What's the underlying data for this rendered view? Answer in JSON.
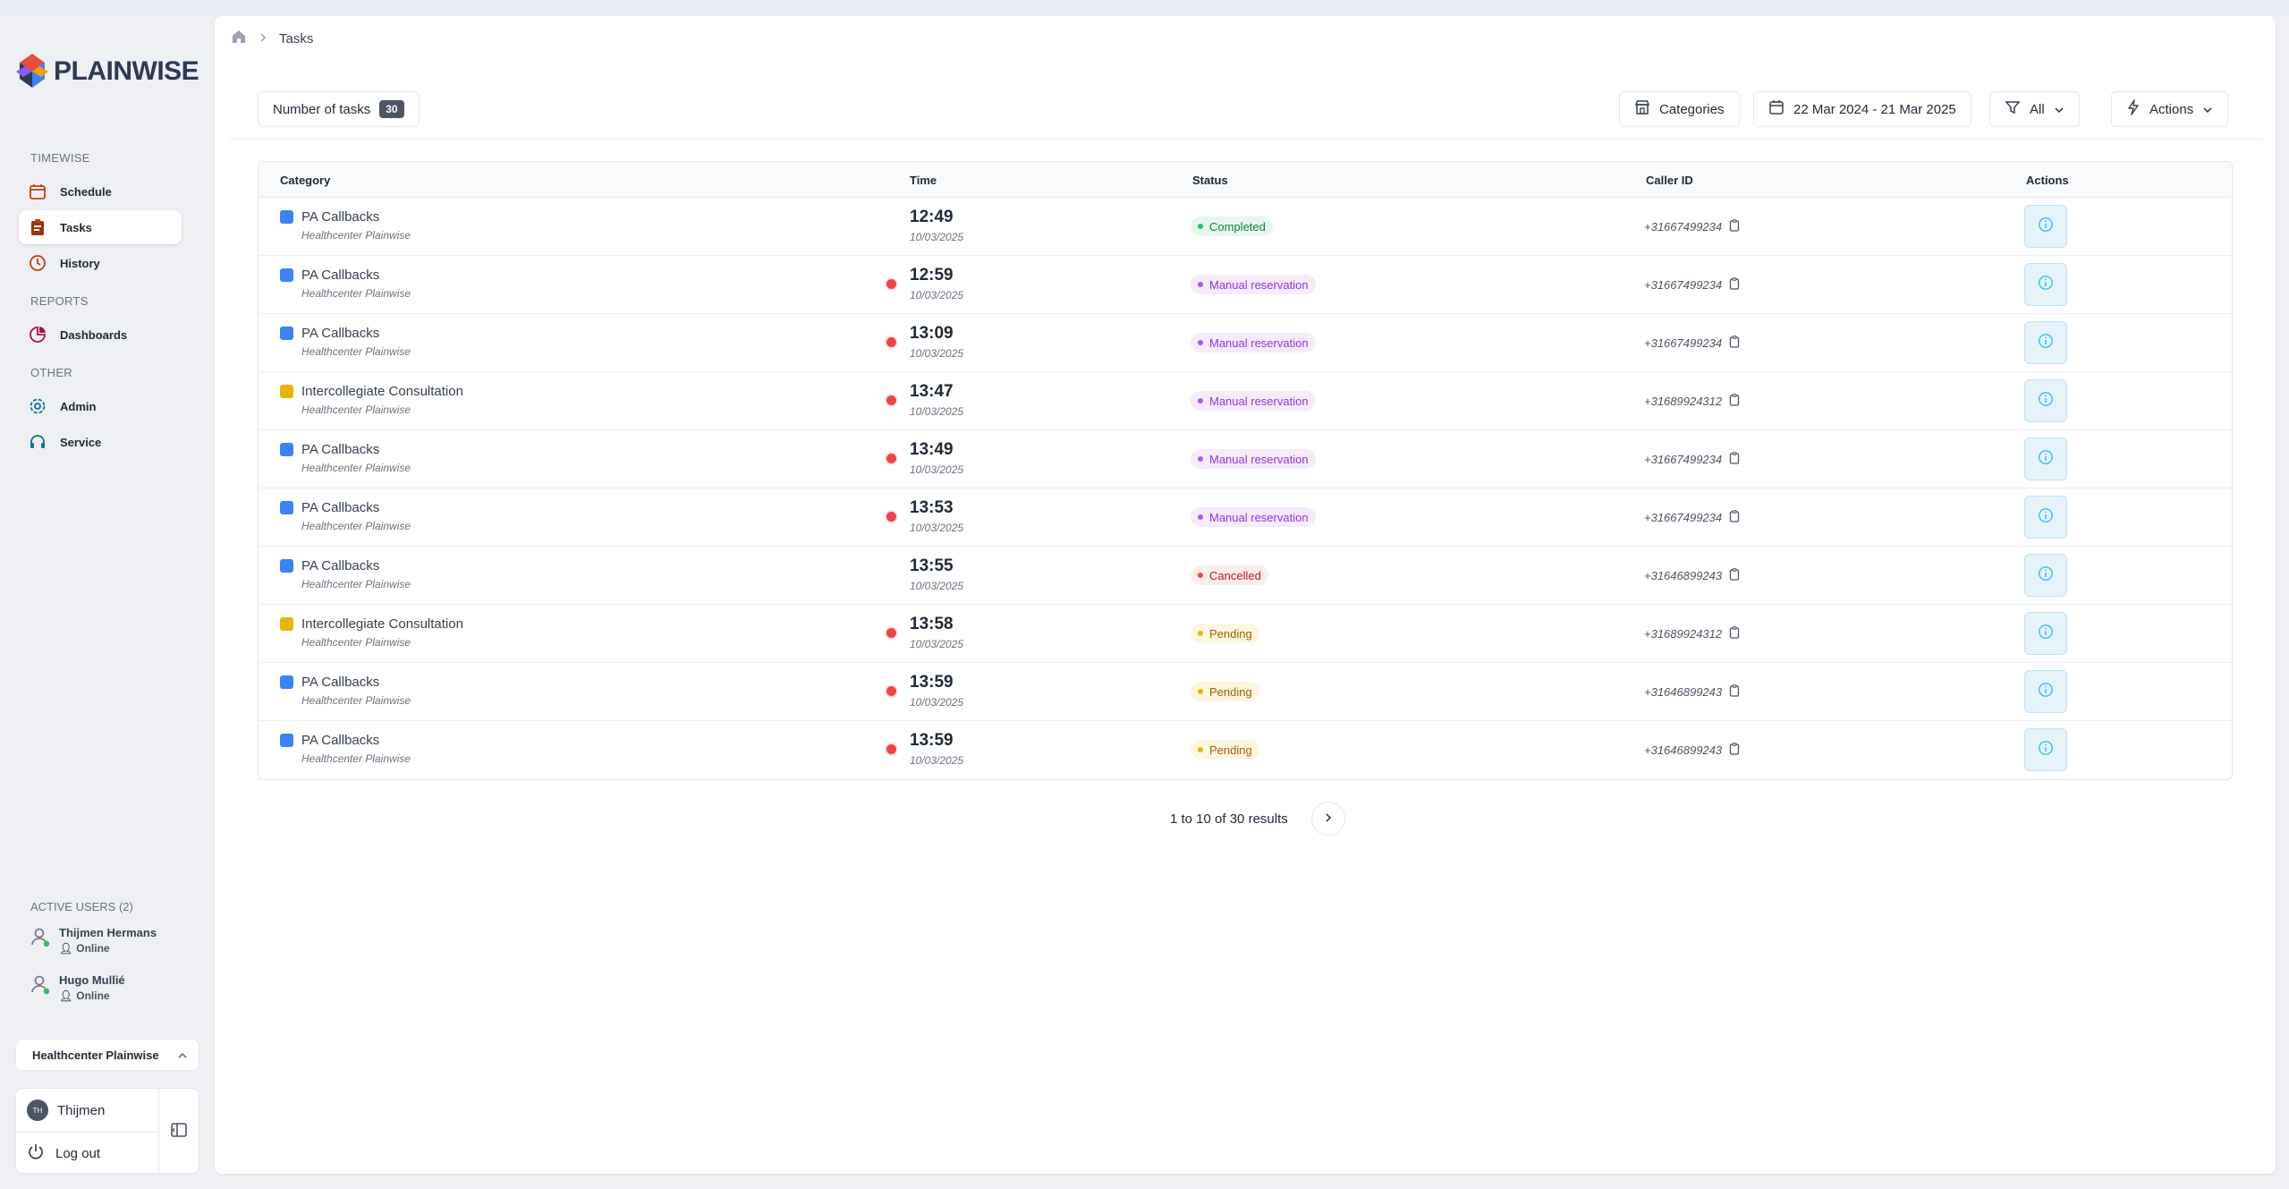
{
  "app": {
    "brand": "PLAINWISE"
  },
  "breadcrumb": {
    "current": "Tasks"
  },
  "sidebar": {
    "sections": [
      {
        "title": "TIMEWISE",
        "items": [
          {
            "label": "Schedule",
            "icon": "calendar-icon",
            "active": false
          },
          {
            "label": "Tasks",
            "icon": "clipboard-icon",
            "active": true
          },
          {
            "label": "History",
            "icon": "clock-icon",
            "active": false
          }
        ]
      },
      {
        "title": "REPORTS",
        "items": [
          {
            "label": "Dashboards",
            "icon": "pie-chart-icon",
            "active": false
          }
        ]
      },
      {
        "title": "OTHER",
        "items": [
          {
            "label": "Admin",
            "icon": "gear-icon",
            "active": false
          },
          {
            "label": "Service",
            "icon": "headset-icon",
            "active": false
          }
        ]
      }
    ],
    "active_users_title": "ACTIVE USERS (2)",
    "active_users": [
      {
        "name": "Thijmen Hermans",
        "status": "Online"
      },
      {
        "name": "Hugo Mullié",
        "status": "Online"
      }
    ],
    "organization": "Healthcenter Plainwise",
    "account": {
      "initials": "TH",
      "name": "Thijmen",
      "logout": "Log out"
    }
  },
  "toolbar": {
    "count_label": "Number of tasks",
    "count_value": "30",
    "categories_label": "Categories",
    "date_range": "22 Mar 2024 - 21 Mar 2025",
    "filter_label": "All",
    "actions_label": "Actions"
  },
  "table": {
    "headers": {
      "category": "Category",
      "time": "Time",
      "status": "Status",
      "caller": "Caller ID",
      "actions": "Actions"
    },
    "rows": [
      {
        "category": "PA Callbacks",
        "sub": "Healthcenter Plainwise",
        "color": "#3b82f6",
        "late": false,
        "time": "12:49",
        "date": "10/03/2025",
        "status": "Completed",
        "status_type": "completed",
        "caller": "+31667499234"
      },
      {
        "category": "PA Callbacks",
        "sub": "Healthcenter Plainwise",
        "color": "#3b82f6",
        "late": true,
        "time": "12:59",
        "date": "10/03/2025",
        "status": "Manual reservation",
        "status_type": "manual",
        "caller": "+31667499234"
      },
      {
        "category": "PA Callbacks",
        "sub": "Healthcenter Plainwise",
        "color": "#3b82f6",
        "late": true,
        "time": "13:09",
        "date": "10/03/2025",
        "status": "Manual reservation",
        "status_type": "manual",
        "caller": "+31667499234"
      },
      {
        "category": "Intercollegiate Consultation",
        "sub": "Healthcenter Plainwise",
        "color": "#eab308",
        "late": true,
        "time": "13:47",
        "date": "10/03/2025",
        "status": "Manual reservation",
        "status_type": "manual",
        "caller": "+31689924312"
      },
      {
        "category": "PA Callbacks",
        "sub": "Healthcenter Plainwise",
        "color": "#3b82f6",
        "late": true,
        "time": "13:49",
        "date": "10/03/2025",
        "status": "Manual reservation",
        "status_type": "manual",
        "caller": "+31667499234"
      },
      {
        "category": "PA Callbacks",
        "sub": "Healthcenter Plainwise",
        "color": "#3b82f6",
        "late": true,
        "time": "13:53",
        "date": "10/03/2025",
        "status": "Manual reservation",
        "status_type": "manual",
        "caller": "+31667499234"
      },
      {
        "category": "PA Callbacks",
        "sub": "Healthcenter Plainwise",
        "color": "#3b82f6",
        "late": false,
        "time": "13:55",
        "date": "10/03/2025",
        "status": "Cancelled",
        "status_type": "cancelled",
        "caller": "+31646899243"
      },
      {
        "category": "Intercollegiate Consultation",
        "sub": "Healthcenter Plainwise",
        "color": "#eab308",
        "late": true,
        "time": "13:58",
        "date": "10/03/2025",
        "status": "Pending",
        "status_type": "pending",
        "caller": "+31689924312"
      },
      {
        "category": "PA Callbacks",
        "sub": "Healthcenter Plainwise",
        "color": "#3b82f6",
        "late": true,
        "time": "13:59",
        "date": "10/03/2025",
        "status": "Pending",
        "status_type": "pending",
        "caller": "+31646899243"
      },
      {
        "category": "PA Callbacks",
        "sub": "Healthcenter Plainwise",
        "color": "#3b82f6",
        "late": true,
        "time": "13:59",
        "date": "10/03/2025",
        "status": "Pending",
        "status_type": "pending",
        "caller": "+31646899243"
      }
    ]
  },
  "pagination": {
    "summary": "1 to 10 of 30 results"
  },
  "colors": {
    "accent": "#3b82f6",
    "completed_bg": "#e8f7ee",
    "completed_fg": "#15803d",
    "completed_dot": "#22c55e",
    "manual_bg": "#f6ebfa",
    "manual_fg": "#9333ea",
    "manual_dot": "#a855f7",
    "cancelled_bg": "#fdecec",
    "cancelled_fg": "#b91c1c",
    "cancelled_dot": "#ef4444",
    "pending_bg": "#fdf6e0",
    "pending_fg": "#a16207",
    "pending_dot": "#eab308",
    "late_dot": "#ef4444"
  }
}
